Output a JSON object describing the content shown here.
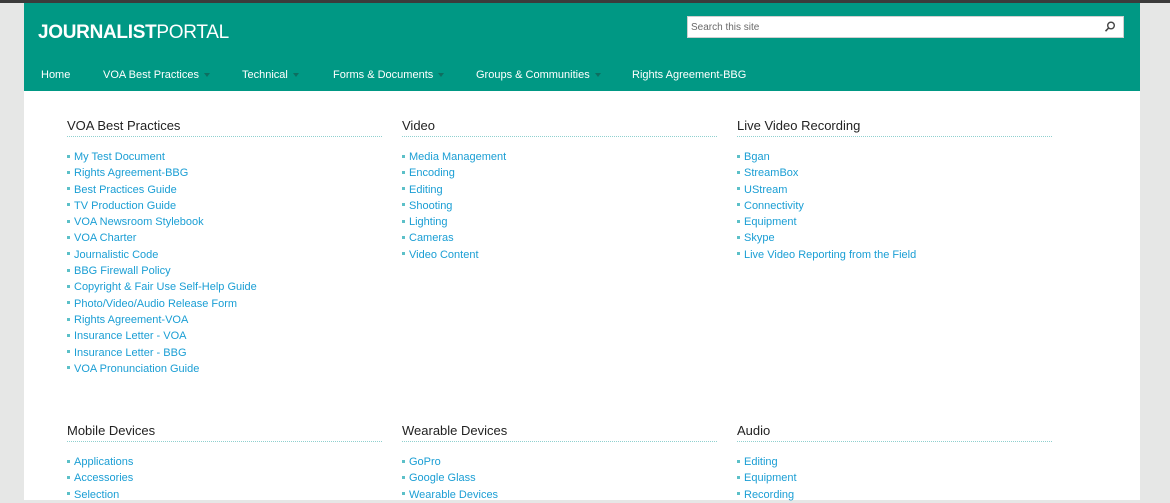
{
  "header": {
    "logo_bold": "JOURNALIST",
    "logo_light": "PORTAL",
    "search_placeholder": "Search this site"
  },
  "nav": [
    {
      "label": "Home",
      "dropdown": false
    },
    {
      "label": "VOA Best Practices",
      "dropdown": true
    },
    {
      "label": "Technical",
      "dropdown": true
    },
    {
      "label": "Forms & Documents",
      "dropdown": true
    },
    {
      "label": "Groups & Communities",
      "dropdown": true
    },
    {
      "label": "Rights Agreement-BBG",
      "dropdown": false
    }
  ],
  "sections": [
    {
      "title": "VOA Best Practices",
      "items": [
        "My Test Document",
        "Rights Agreement-BBG",
        "Best Practices Guide",
        "TV Production Guide",
        "VOA Newsroom Stylebook",
        "VOA Charter",
        "Journalistic Code",
        "BBG Firewall Policy",
        "Copyright & Fair Use Self-Help Guide",
        "Photo/Video/Audio Release Form",
        "Rights Agreement-VOA",
        "Insurance Letter - VOA",
        "Insurance Letter - BBG",
        "VOA Pronunciation Guide"
      ]
    },
    {
      "title": "Video",
      "items": [
        "Media Management",
        "Encoding",
        "Editing",
        "Shooting",
        "Lighting",
        "Cameras",
        "Video Content"
      ]
    },
    {
      "title": "Live Video Recording",
      "items": [
        "Bgan",
        "StreamBox",
        "UStream",
        "Connectivity",
        "Equipment",
        "Skype",
        "Live Video Reporting from the Field"
      ]
    },
    {
      "title": "Mobile Devices",
      "items": [
        "Applications",
        "Accessories",
        "Selection"
      ]
    },
    {
      "title": "Wearable Devices",
      "items": [
        "GoPro",
        "Google Glass",
        "Wearable Devices"
      ]
    },
    {
      "title": "Audio",
      "items": [
        "Editing",
        "Equipment",
        "Recording"
      ]
    }
  ],
  "colors": {
    "brand": "#009884",
    "link": "#1a9ed4"
  }
}
